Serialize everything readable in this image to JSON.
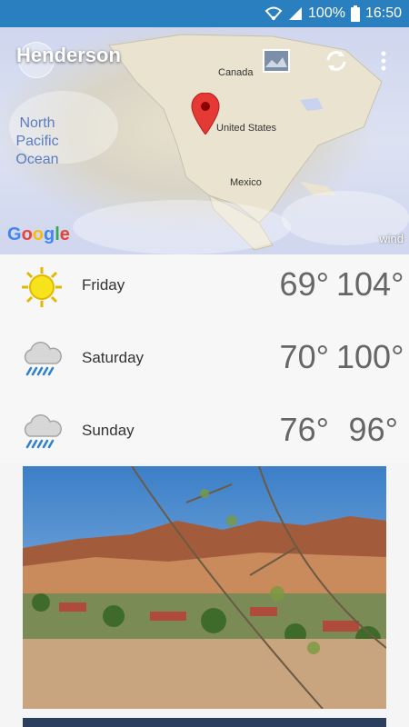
{
  "status": {
    "battery": "100%",
    "time": "16:50"
  },
  "header": {
    "city": "Henderson"
  },
  "map": {
    "labels": {
      "canada": "Canada",
      "united_states": "United States",
      "mexico": "Mexico",
      "ocean": "North Pacific Ocean"
    },
    "logo": "Google",
    "watermark": "wind"
  },
  "forecast": [
    {
      "day": "Friday",
      "low": "69°",
      "high": "104°",
      "icon": "sun-icon"
    },
    {
      "day": "Saturday",
      "low": "70°",
      "high": "100°",
      "icon": "rain-cloud-icon"
    },
    {
      "day": "Sunday",
      "low": "76°",
      "high": "96°",
      "icon": "rain-cloud-icon"
    }
  ]
}
